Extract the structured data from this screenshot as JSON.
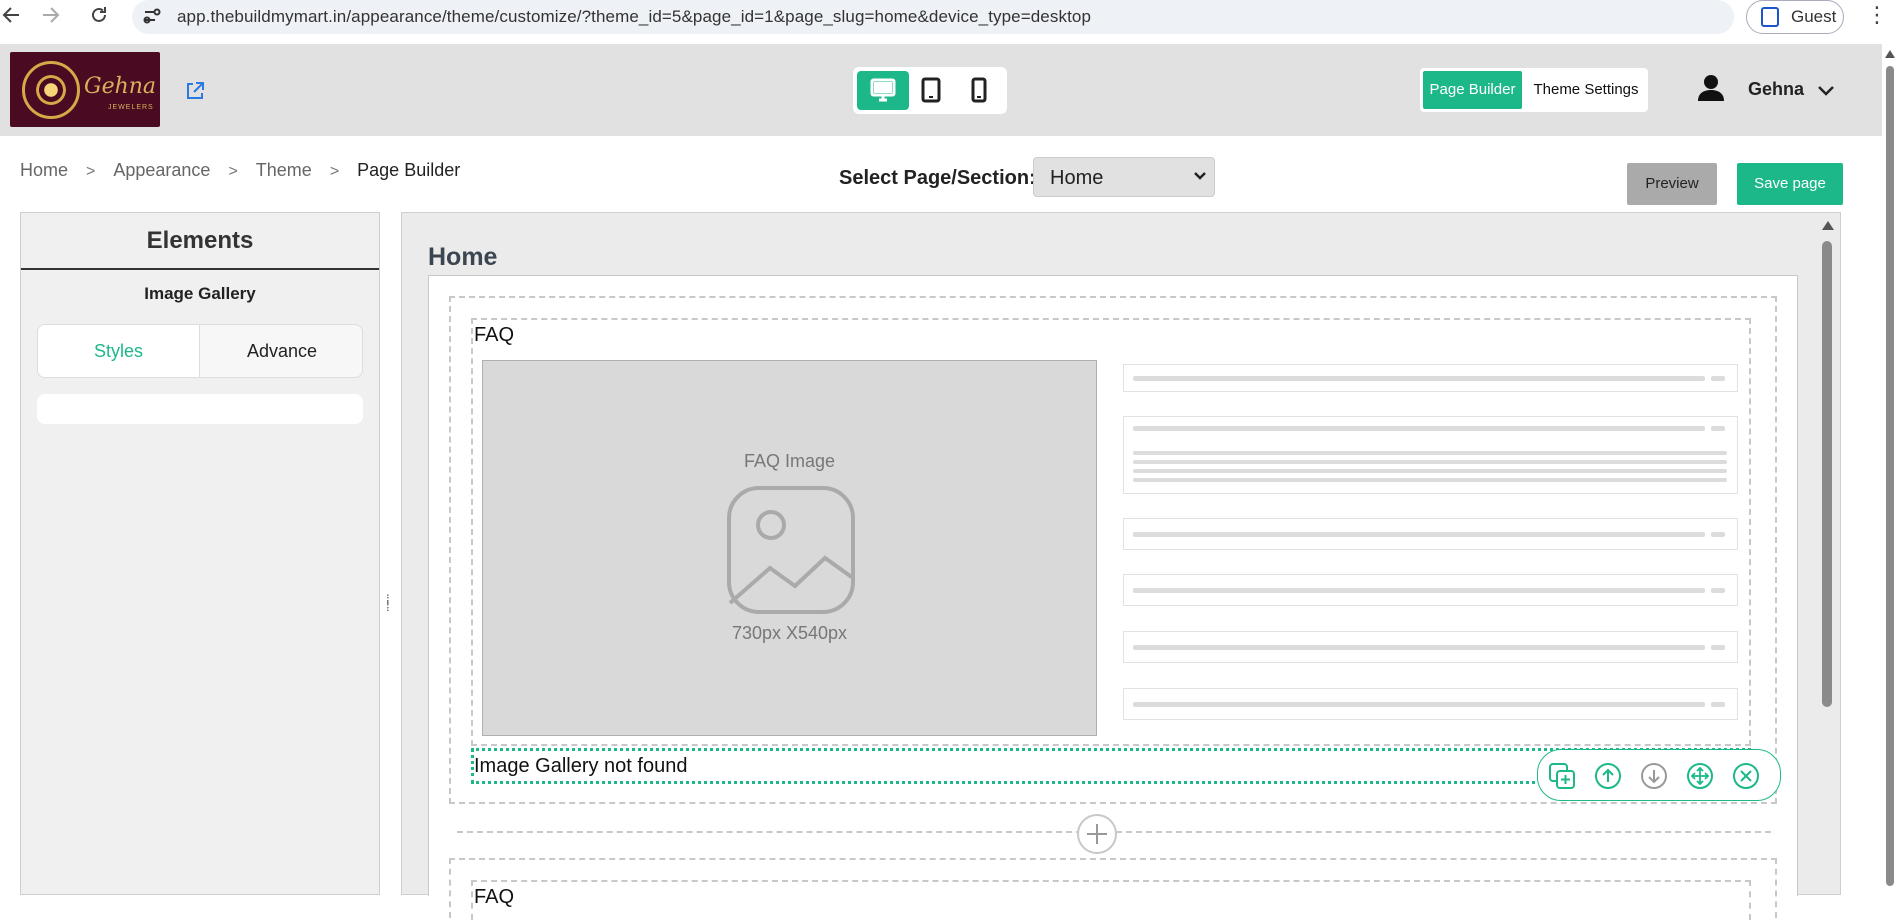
{
  "browser": {
    "url": "app.thebuildmymart.in/appearance/theme/customize/?theme_id=5&page_id=1&page_slug=home&device_type=desktop",
    "profile_label": "Guest"
  },
  "header": {
    "logo": {
      "name": "Gehna",
      "subtitle": "JEWELERS"
    },
    "devices": [
      {
        "icon": "desktop-icon",
        "active": true
      },
      {
        "icon": "tablet-icon",
        "active": false
      },
      {
        "icon": "mobile-icon",
        "active": false
      }
    ],
    "mode_tabs": {
      "page_builder": "Page Builder",
      "theme_settings": "Theme Settings"
    },
    "user_name": "Gehna"
  },
  "breadcrumb": [
    "Home",
    "Appearance",
    "Theme",
    "Page Builder"
  ],
  "toolbar": {
    "select_label": "Select Page/Section:",
    "selected_page": "Home",
    "preview_label": "Preview",
    "save_label": "Save page"
  },
  "elements_panel": {
    "title": "Elements",
    "selected_element": "Image Gallery",
    "tabs": {
      "styles": "Styles",
      "advance": "Advance"
    },
    "active_tab": "Styles"
  },
  "canvas": {
    "page_title": "Home",
    "faq_label": "FAQ",
    "faq_image_label": "FAQ Image",
    "faq_image_size": "730px X540px",
    "gallery_message": "Image Gallery not found",
    "tools": [
      "duplicate-icon",
      "move-up-icon",
      "move-down-icon",
      "drag-move-icon",
      "delete-icon"
    ],
    "second_section_label": "FAQ"
  },
  "colors": {
    "accent": "#1db88a",
    "header_bg": "#e1e1e1",
    "canvas_bg": "#ebebeb",
    "logo_bg": "#4a0a22",
    "logo_gold": "#d9b15a"
  }
}
